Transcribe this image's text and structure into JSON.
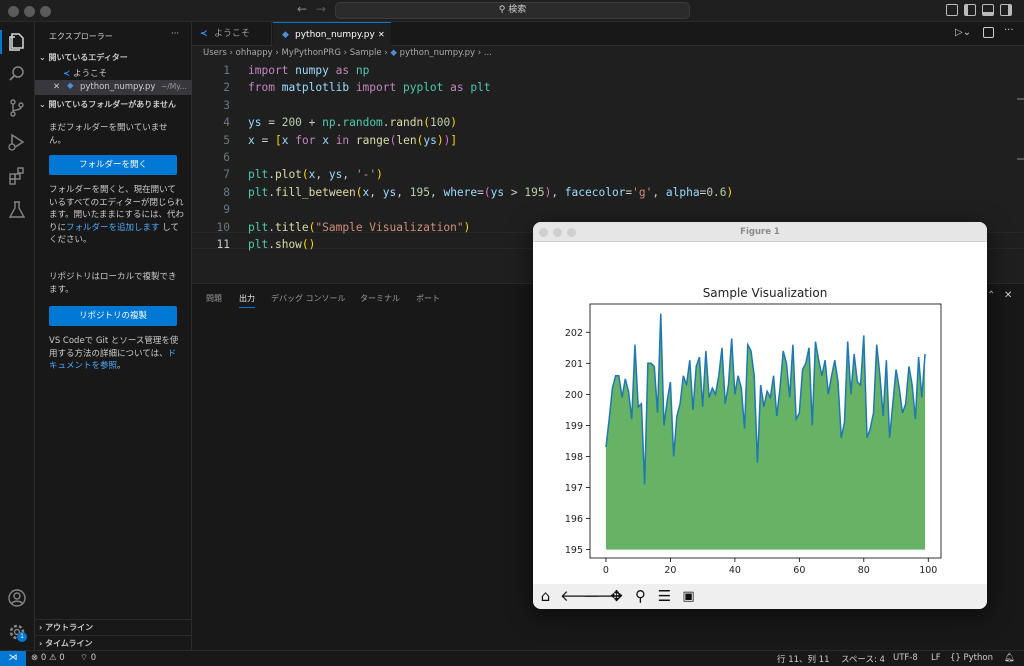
{
  "titlebar": {
    "search": "検索"
  },
  "sidebar": {
    "title": "エクスプローラー",
    "more": "···",
    "open_editors_header": "開いているエディター",
    "open_editors": [
      {
        "label": "ようこそ",
        "desc": ""
      },
      {
        "label": "python_numpy.py",
        "desc": "~/My..."
      }
    ],
    "no_folder_header": "開いているフォルダーがありません",
    "msg1": "まだフォルダーを開いていません。",
    "open_folder_button": "フォルダーを開く",
    "msg2": "フォルダーを開くと、現在開いているすべてのエディターが閉じられます。開いたままにするには、代わりに",
    "msg2_link": "フォルダーを追加します",
    "msg2_end": "してください。",
    "msg3": "リポジトリはローカルで複製できます。",
    "clone_button": "リポジトリの複製",
    "msg4": "VS Codeで Git とソース管理を使用する方法の詳細については、",
    "msg4_link": "ドキュメントを参照",
    "msg4_end": "。",
    "outline": "アウトライン",
    "timeline": "タイムライン"
  },
  "tabs": [
    {
      "label": "ようこそ",
      "active": false
    },
    {
      "label": "python_numpy.py",
      "active": true
    }
  ],
  "breadcrumb": [
    "Users",
    "ohhappy",
    "MyPythonPRG",
    "Sample",
    "python_numpy.py",
    "..."
  ],
  "editor": {
    "line_numbers": [
      "1",
      "2",
      "3",
      "4",
      "5",
      "6",
      "7",
      "8",
      "9",
      "10",
      "11"
    ],
    "lines": [
      "import numpy as np",
      "from matplotlib import pyplot as plt",
      "",
      "ys = 200 + np.random.randn(100)",
      "x = [x for x in range(len(ys))]",
      "",
      "plt.plot(x, ys, '-')",
      "plt.fill_between(x, ys, 195, where=(ys > 195), facecolor='g', alpha=0.6)",
      "",
      "plt.title(\"Sample Visualization\")",
      "plt.show()"
    ]
  },
  "panel": {
    "tabs": [
      "問題",
      "出力",
      "デバッグ コンソール",
      "ターミナル",
      "ポート"
    ],
    "active": "出力"
  },
  "statusbar": {
    "errors": "0",
    "warnings": "0",
    "ports": "0",
    "position": "行 11、列 11",
    "spaces": "スペース: 4",
    "encoding": "UTF-8",
    "eol": "LF",
    "language": "Python",
    "braces": "{}"
  },
  "figure": {
    "window_title": "Figure 1"
  },
  "chart_data": {
    "type": "area",
    "title": "Sample Visualization",
    "xlabel": "",
    "ylabel": "",
    "xlim": [
      -4.95,
      103.95
    ],
    "ylim": [
      194.73,
      202.91
    ],
    "xticks": [
      0,
      20,
      40,
      60,
      80,
      100
    ],
    "yticks": [
      195,
      196,
      197,
      198,
      199,
      200,
      201,
      202
    ],
    "baseline": 195,
    "line_color": "#1f77b4",
    "fill_color": "#008000",
    "fill_alpha": 0.6,
    "x": [
      0,
      1,
      2,
      3,
      4,
      5,
      6,
      7,
      8,
      9,
      10,
      11,
      12,
      13,
      14,
      15,
      16,
      17,
      18,
      19,
      20,
      21,
      22,
      23,
      24,
      25,
      26,
      27,
      28,
      29,
      30,
      31,
      32,
      33,
      34,
      35,
      36,
      37,
      38,
      39,
      40,
      41,
      42,
      43,
      44,
      45,
      46,
      47,
      48,
      49,
      50,
      51,
      52,
      53,
      54,
      55,
      56,
      57,
      58,
      59,
      60,
      61,
      62,
      63,
      64,
      65,
      66,
      67,
      68,
      69,
      70,
      71,
      72,
      73,
      74,
      75,
      76,
      77,
      78,
      79,
      80,
      81,
      82,
      83,
      84,
      85,
      86,
      87,
      88,
      89,
      90,
      91,
      92,
      93,
      94,
      95,
      96,
      97,
      98,
      99
    ],
    "y": [
      198.3,
      199.2,
      200.2,
      200.6,
      200.6,
      199.9,
      200.5,
      200.1,
      199.2,
      201.6,
      199.6,
      199.7,
      197.1,
      201.0,
      201.0,
      200.9,
      199.4,
      202.6,
      199.0,
      199.8,
      200.4,
      198.0,
      199.3,
      199.7,
      200.6,
      200.3,
      201.1,
      199.5,
      200.9,
      201.2,
      199.6,
      201.4,
      199.9,
      200.2,
      200.0,
      200.6,
      201.5,
      199.7,
      200.3,
      201.8,
      200.0,
      200.6,
      200.2,
      198.9,
      201.6,
      201.4,
      200.6,
      197.8,
      200.3,
      199.6,
      200.1,
      199.9,
      200.6,
      199.3,
      200.2,
      201.4,
      201.0,
      199.9,
      201.6,
      199.2,
      199.4,
      200.8,
      201.0,
      201.5,
      199.0,
      201.7,
      201.1,
      200.6,
      201.1,
      200.0,
      200.6,
      201.1,
      200.4,
      198.6,
      199.1,
      201.7,
      200.0,
      201.3,
      200.4,
      200.3,
      201.9,
      198.6,
      198.9,
      199.4,
      201.6,
      200.6,
      199.3,
      201.1,
      198.6,
      199.7,
      200.8,
      200.2,
      199.4,
      199.7,
      200.9,
      200.3,
      199.2,
      201.2,
      199.9,
      201.3
    ]
  }
}
